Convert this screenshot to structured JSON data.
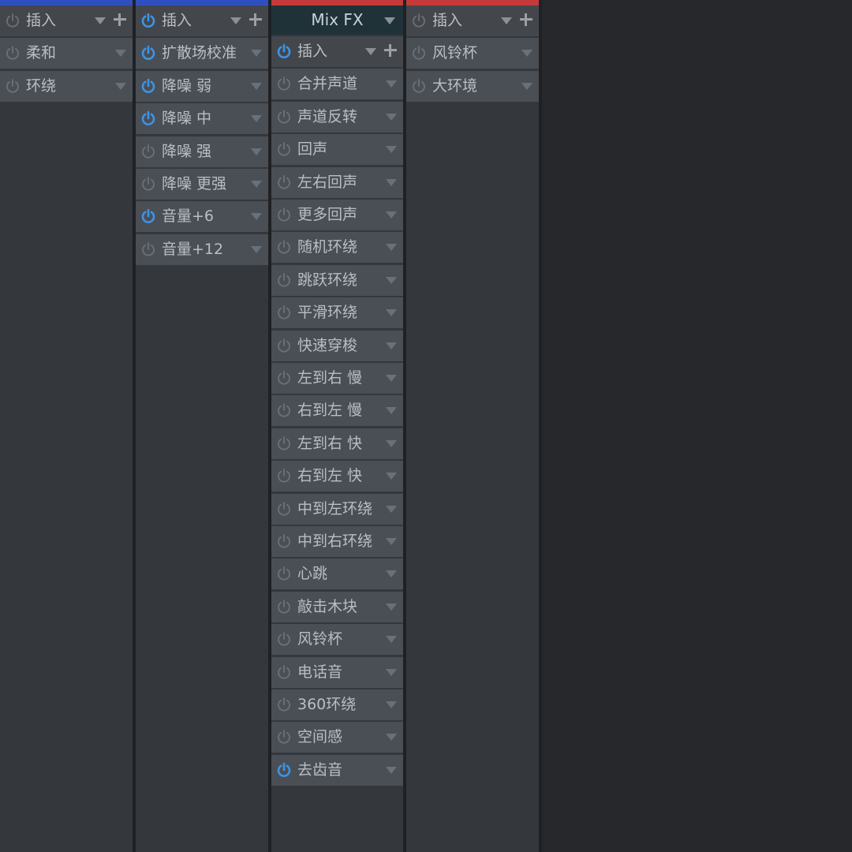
{
  "colors": {
    "blue": "#2f4fbf",
    "red": "#c43a3a",
    "power_on": "#3d93e6",
    "power_off": "#6b7178"
  },
  "strips": [
    {
      "color": "#2f4fbf",
      "header": {
        "label": "插入",
        "power": false
      },
      "slots": [
        {
          "label": "柔和",
          "on": false
        },
        {
          "label": "环绕",
          "on": false
        }
      ]
    },
    {
      "color": "#2f4fbf",
      "header": {
        "label": "插入",
        "power": true
      },
      "slots": [
        {
          "label": "扩散场校准",
          "on": true
        },
        {
          "label": "降噪 弱",
          "on": true
        },
        {
          "label": "降噪 中",
          "on": true
        },
        {
          "label": "降噪 强",
          "on": false
        },
        {
          "label": "降噪 更强",
          "on": false
        },
        {
          "label": "音量+6",
          "on": true
        },
        {
          "label": "音量+12",
          "on": false
        }
      ]
    },
    {
      "color": "#c43a3a",
      "mixfx": "Mix FX",
      "header": {
        "label": "插入",
        "power": true
      },
      "slots": [
        {
          "label": "合并声道",
          "on": false
        },
        {
          "label": "声道反转",
          "on": false
        },
        {
          "label": "回声",
          "on": false
        },
        {
          "label": "左右回声",
          "on": false
        },
        {
          "label": "更多回声",
          "on": false
        },
        {
          "label": "随机环绕",
          "on": false
        },
        {
          "label": "跳跃环绕",
          "on": false
        },
        {
          "label": "平滑环绕",
          "on": false
        },
        {
          "label": "快速穿梭",
          "on": false
        },
        {
          "label": "左到右 慢",
          "on": false
        },
        {
          "label": "右到左 慢",
          "on": false
        },
        {
          "label": "左到右 快",
          "on": false
        },
        {
          "label": "右到左 快",
          "on": false
        },
        {
          "label": "中到左环绕",
          "on": false
        },
        {
          "label": "中到右环绕",
          "on": false
        },
        {
          "label": "心跳",
          "on": false
        },
        {
          "label": "敲击木块",
          "on": false
        },
        {
          "label": "风铃杯",
          "on": false
        },
        {
          "label": "电话音",
          "on": false
        },
        {
          "label": "360环绕",
          "on": false
        },
        {
          "label": "空间感",
          "on": false
        },
        {
          "label": "去齿音",
          "on": true
        }
      ]
    },
    {
      "color": "#c43a3a",
      "header": {
        "label": "插入",
        "power": false
      },
      "slots": [
        {
          "label": "风铃杯",
          "on": false
        },
        {
          "label": "大环境",
          "on": false
        }
      ]
    }
  ]
}
